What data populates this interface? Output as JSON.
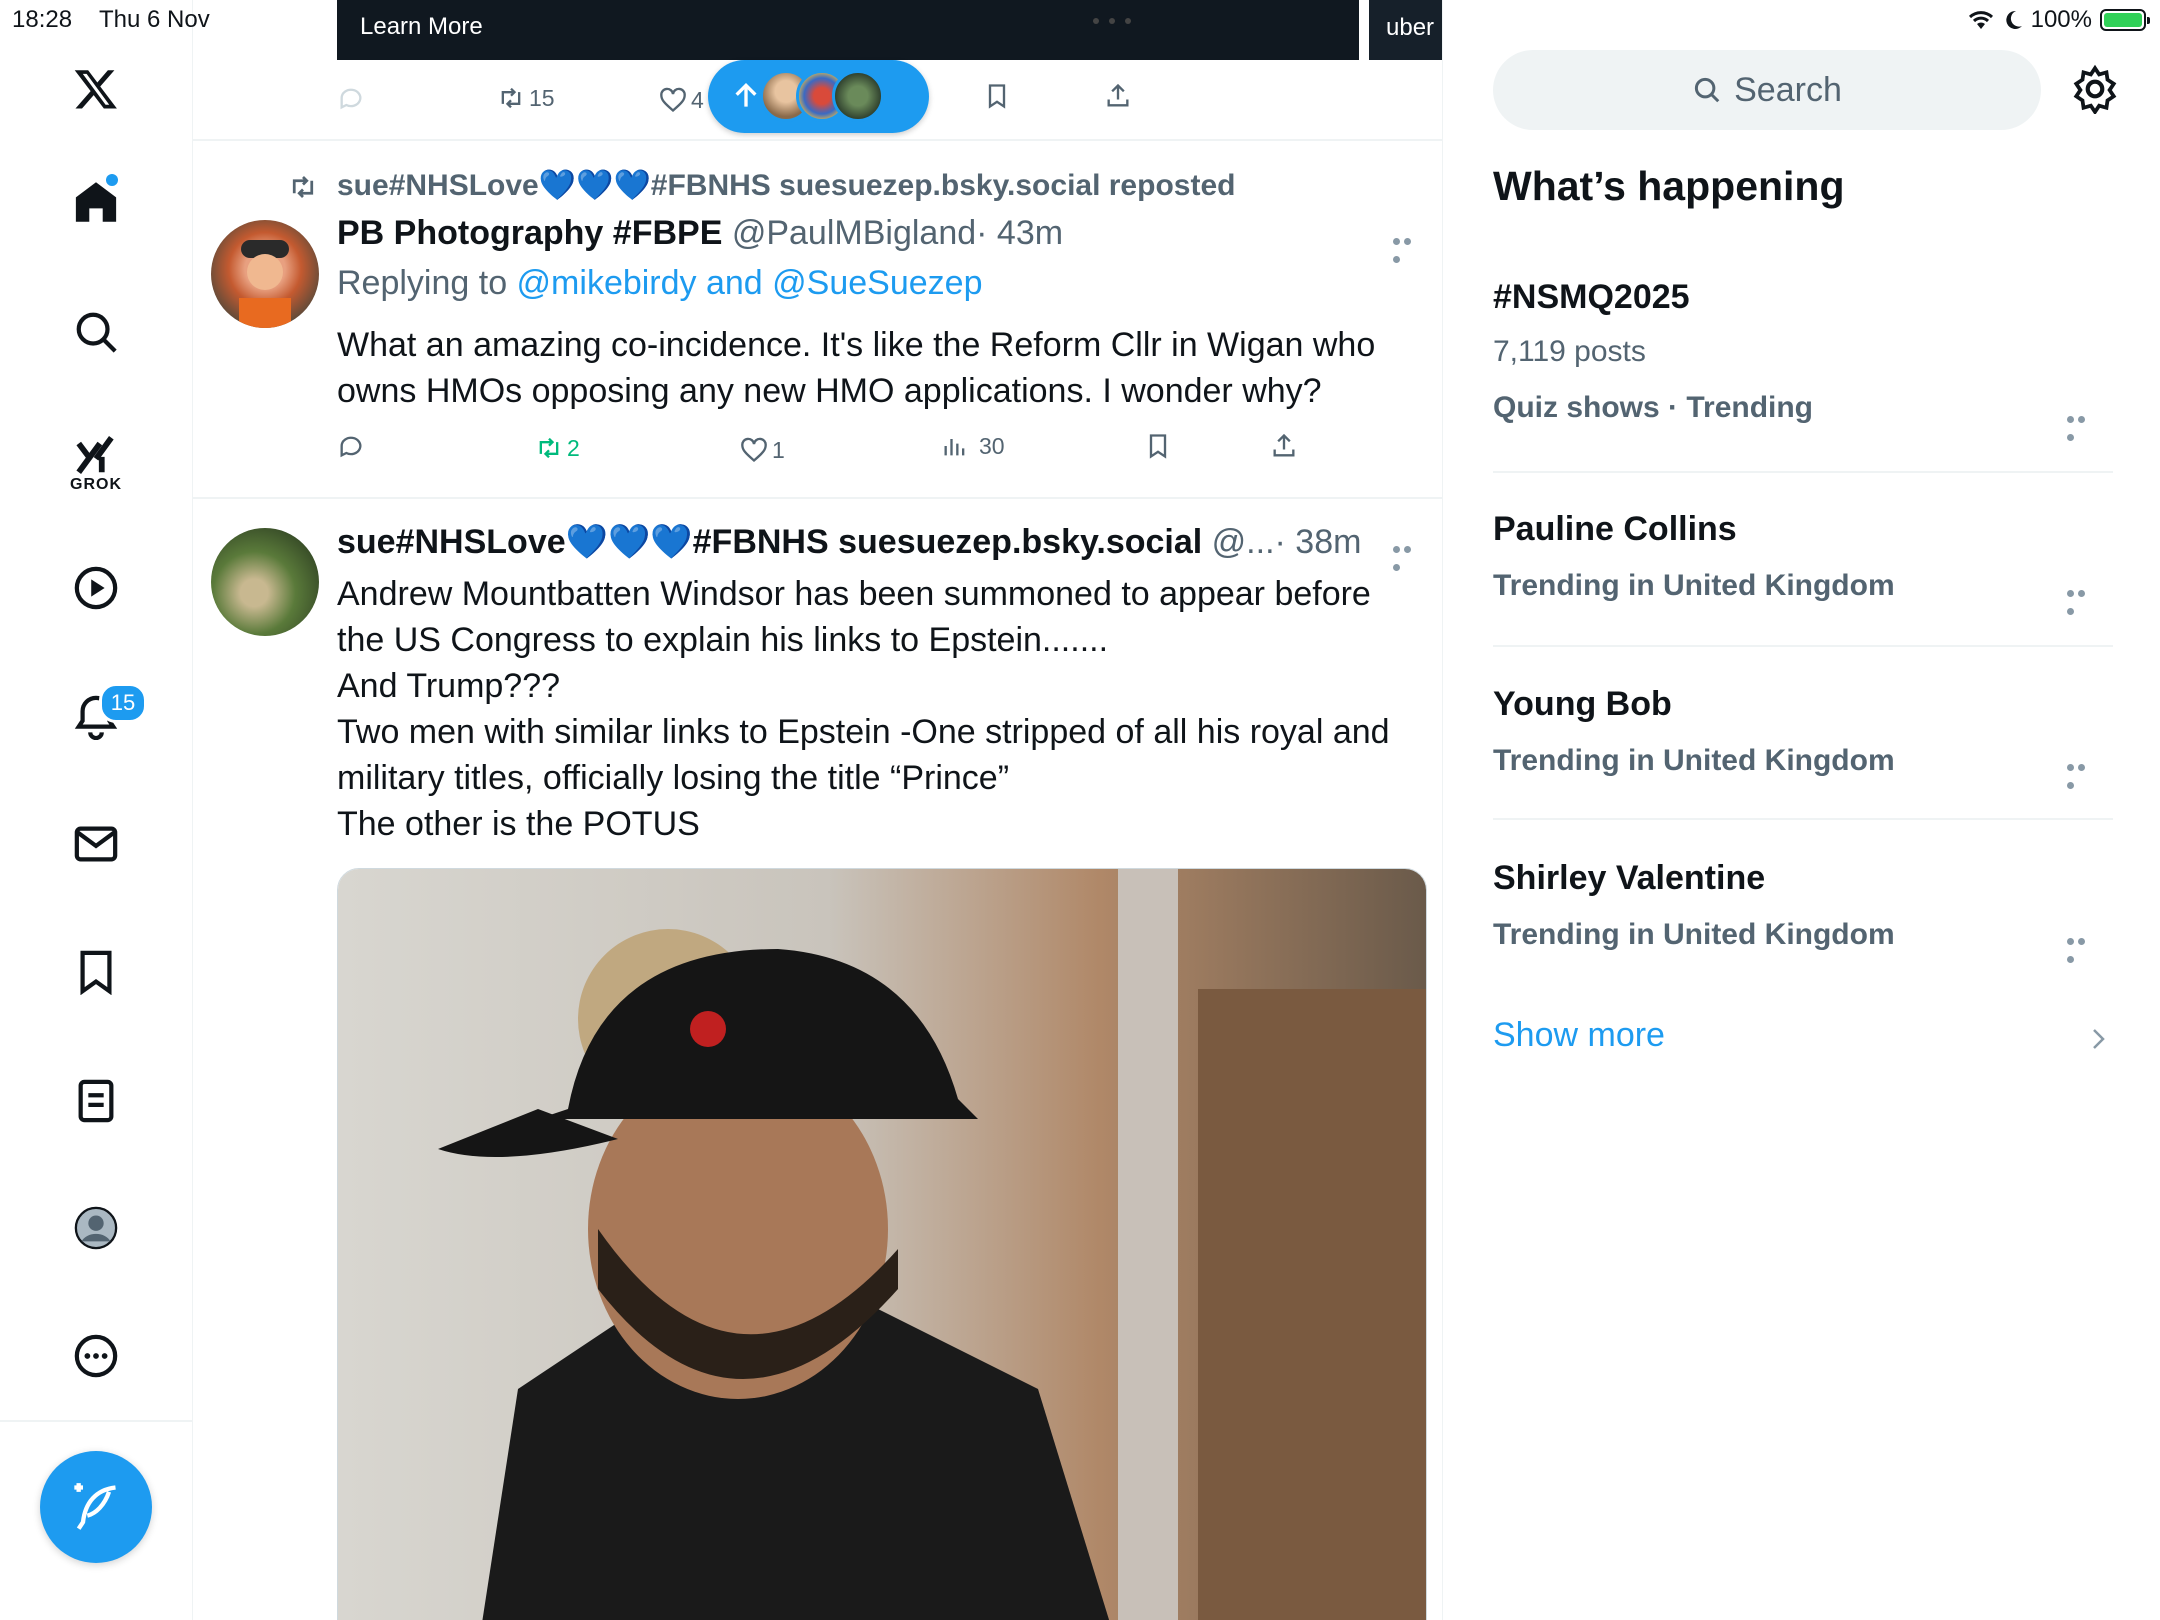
{
  "status_bar": {
    "time": "18:28",
    "date": "Thu 6 Nov",
    "battery": "100%"
  },
  "left_nav": {
    "grok_label": "GROK",
    "notifications_badge": "15",
    "items": [
      "X logo",
      "Home",
      "Explore",
      "Grok",
      "Video",
      "Notifications",
      "Messages",
      "Bookmarks",
      "Lists",
      "Profile",
      "More"
    ]
  },
  "feed": {
    "top_card": {
      "learn_more": "Learn More",
      "side_card_text": "uber",
      "retweets": "15",
      "likes": "4"
    },
    "tweet1": {
      "repost_line": "sue#NHSLove💙💙💙#FBNHS suesuezep.bsky.social reposted",
      "author": "PB Photography #FBPE",
      "handle": "@PaulMBigland",
      "time": "· 43m",
      "replying_prefix": "Replying to ",
      "replying_to": "@mikebirdy and @SueSuezep",
      "text_line1": "What an amazing co-incidence. It's like the Reform Cllr in Wigan who",
      "text_line2": "owns HMOs opposing any new HMO applications. I wonder why?",
      "retweets": "2",
      "likes": "1",
      "views": "30"
    },
    "tweet2": {
      "author": "sue#NHSLove💙💙💙#FBNHS suesuezep.bsky.social",
      "handle": "@...",
      "time": "· 38m",
      "lines": [
        "Andrew Mountbatten Windsor has been summoned to appear before",
        "the US Congress to explain his links to Epstein.......",
        "And Trump???",
        "Two men with similar links to Epstein -One stripped of all his royal and",
        "military titles, officially losing the title “Prince”",
        "The other is the POTUS"
      ]
    }
  },
  "right_col": {
    "search_placeholder": "Search",
    "title": "What’s happening",
    "trends": [
      {
        "name": "#NSMQ2025",
        "posts": "7,119 posts",
        "context": "Quiz shows · Trending"
      },
      {
        "name": "Pauline Collins",
        "context": "Trending in United Kingdom"
      },
      {
        "name": "Young Bob",
        "context": "Trending in United Kingdom"
      },
      {
        "name": "Shirley Valentine",
        "context": "Trending in United Kingdom"
      }
    ],
    "show_more": "Show more"
  },
  "colors": {
    "accent": "#1d9bf0",
    "retweet_green": "#00ba7c",
    "secondary_text": "#536471"
  }
}
